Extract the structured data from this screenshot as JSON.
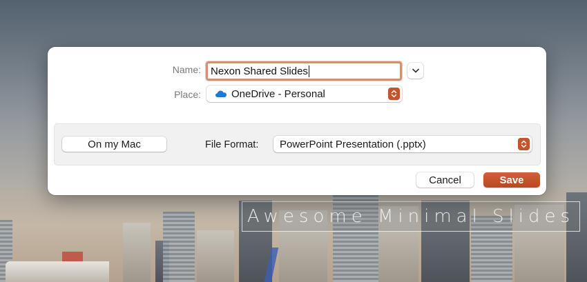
{
  "background": {
    "slide_title": "Awesome Minimal Slides"
  },
  "dialog": {
    "name_label": "Name:",
    "name_value": "Nexon Shared Slides",
    "place_label": "Place:",
    "place_value": "OneDrive - Personal",
    "place_icon": "onedrive-cloud-icon",
    "on_my_mac_label": "On my Mac",
    "file_format_label": "File Format:",
    "file_format_value": "PowerPoint Presentation (.pptx)",
    "cancel_label": "Cancel",
    "save_label": "Save",
    "accent_color": "#c2552c",
    "onedrive_color": "#1f78d1"
  }
}
